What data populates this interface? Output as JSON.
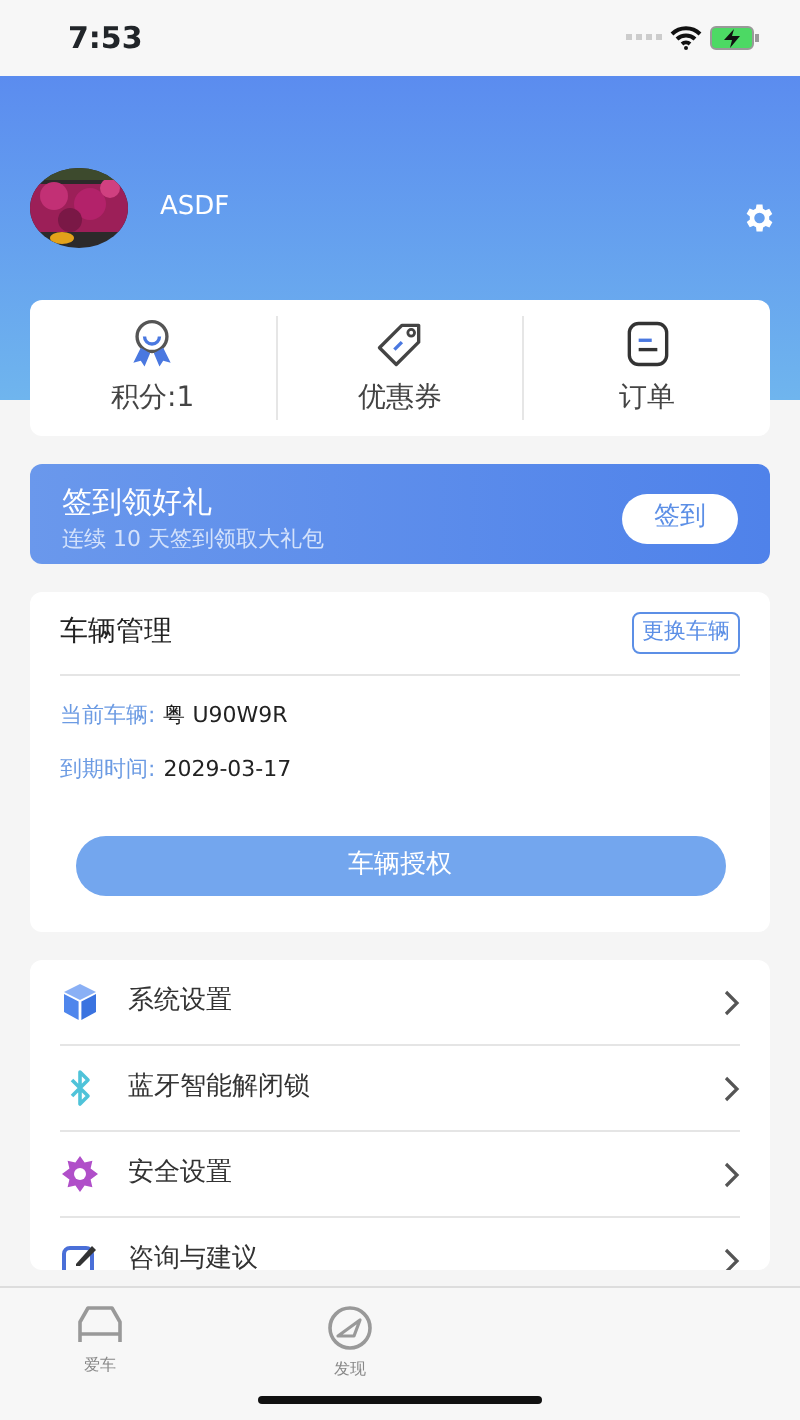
{
  "status_bar": {
    "time": "7:53"
  },
  "profile": {
    "name": "ASDF"
  },
  "stats": [
    {
      "kind": "points",
      "label": "积分:1"
    },
    {
      "kind": "coupon",
      "label": "优惠券"
    },
    {
      "kind": "order",
      "label": "订单"
    }
  ],
  "checkin": {
    "title": "签到领好礼",
    "subtitle": "连续 10 天签到领取大礼包",
    "button": "签到"
  },
  "vehicle": {
    "title": "车辆管理",
    "change_button": "更换车辆",
    "fields": [
      {
        "label": "当前车辆:",
        "value": "粤 U90W9R"
      },
      {
        "label": "到期时间:",
        "value": "2029-03-17"
      }
    ],
    "button": "车辆授权"
  },
  "menu": [
    {
      "kind": "system",
      "label": "系统设置"
    },
    {
      "kind": "bluetooth",
      "label": "蓝牙智能解闭锁"
    },
    {
      "kind": "security",
      "label": "安全设置"
    },
    {
      "kind": "feedback",
      "label": "咨询与建议"
    }
  ],
  "tab_bar": [
    {
      "kind": "car",
      "label": "爱车"
    },
    {
      "kind": "discover",
      "label": "发现"
    }
  ]
}
